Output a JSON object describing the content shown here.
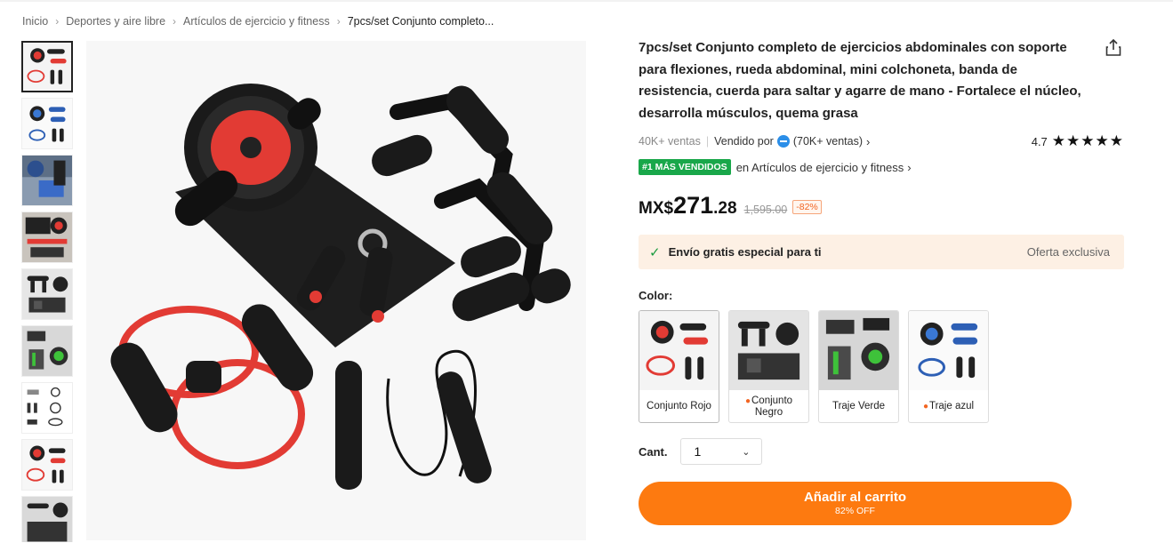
{
  "breadcrumb": {
    "items": [
      "Inicio",
      "Deportes y aire libre",
      "Artículos de ejercicio y fitness",
      "7pcs/set Conjunto completo..."
    ],
    "separator": "›"
  },
  "thumbnails": [
    "thumb-kit-red",
    "thumb-kit-blue",
    "thumb-kit-photo-blue",
    "thumb-kit-photo-red",
    "thumb-kit-black",
    "thumb-kit-green",
    "thumb-diagram",
    "thumb-kit-red-2",
    "thumb-kit-black-2"
  ],
  "product": {
    "title": "7pcs/set Conjunto completo de ejercicios abdominales con soporte para flexiones, rueda abdominal, mini colchoneta, banda de resistencia, cuerda para saltar y agarre de mano - Fortalece el núcleo, desarrolla músculos, quema grasa",
    "sales": "40K+ ventas",
    "sold_by_label": "Vendido por",
    "store_sales": "(70K+ ventas)",
    "rating": "4.7",
    "stars": "★★★★★",
    "best_badge": "#1 MÁS VENDIDOS",
    "best_category": "en Artículos de ejercicio y fitness",
    "chevron": "›"
  },
  "price": {
    "currency": "MX$",
    "integer": "271",
    "decimal": ".28",
    "original": "1,595.00",
    "discount": "-82%"
  },
  "shipping": {
    "check": "✓",
    "text": "Envío gratis especial para ti",
    "offer": "Oferta exclusiva"
  },
  "color": {
    "label": "Color:",
    "options": [
      {
        "label": "Conjunto Rojo",
        "hot": false
      },
      {
        "label": "Conjunto Negro",
        "hot": true
      },
      {
        "label": "Traje Verde",
        "hot": false
      },
      {
        "label": "Traje azul",
        "hot": true
      }
    ]
  },
  "quantity": {
    "label": "Cant.",
    "value": "1",
    "caret": "⌄"
  },
  "cart": {
    "label": "Añadir al carrito",
    "sub": "82% OFF"
  },
  "colors": {
    "accent": "#fd7a10",
    "best_green": "#19a74a",
    "ship_bg": "#fdf0e4",
    "product_red": "#e23b34"
  }
}
